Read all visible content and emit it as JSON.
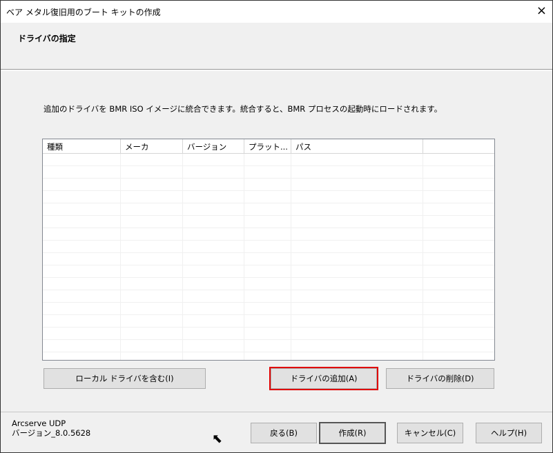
{
  "window": {
    "title": "ベア メタル復旧用のブート キットの作成",
    "close_icon": "×"
  },
  "header": {
    "title": "ドライバの指定"
  },
  "description": "追加のドライバを BMR ISO イメージに統合できます。統合すると、BMR プロセスの起動時にロードされます。",
  "table": {
    "columns": [
      "種類",
      "メーカ",
      "バージョン",
      "プラット...",
      "パス",
      ""
    ],
    "rows": []
  },
  "buttons": {
    "include_local": "ローカル ドライバを含む(I)",
    "add_driver": "ドライバの追加(A)",
    "remove_driver": "ドライバの削除(D)",
    "back": "戻る(B)",
    "create": "作成(R)",
    "cancel": "キャンセル(C)",
    "help": "ヘルプ(H)"
  },
  "footer": {
    "product": "Arcserve UDP",
    "version": "バージョン_8.0.5628"
  },
  "highlight_color": "#e00000"
}
